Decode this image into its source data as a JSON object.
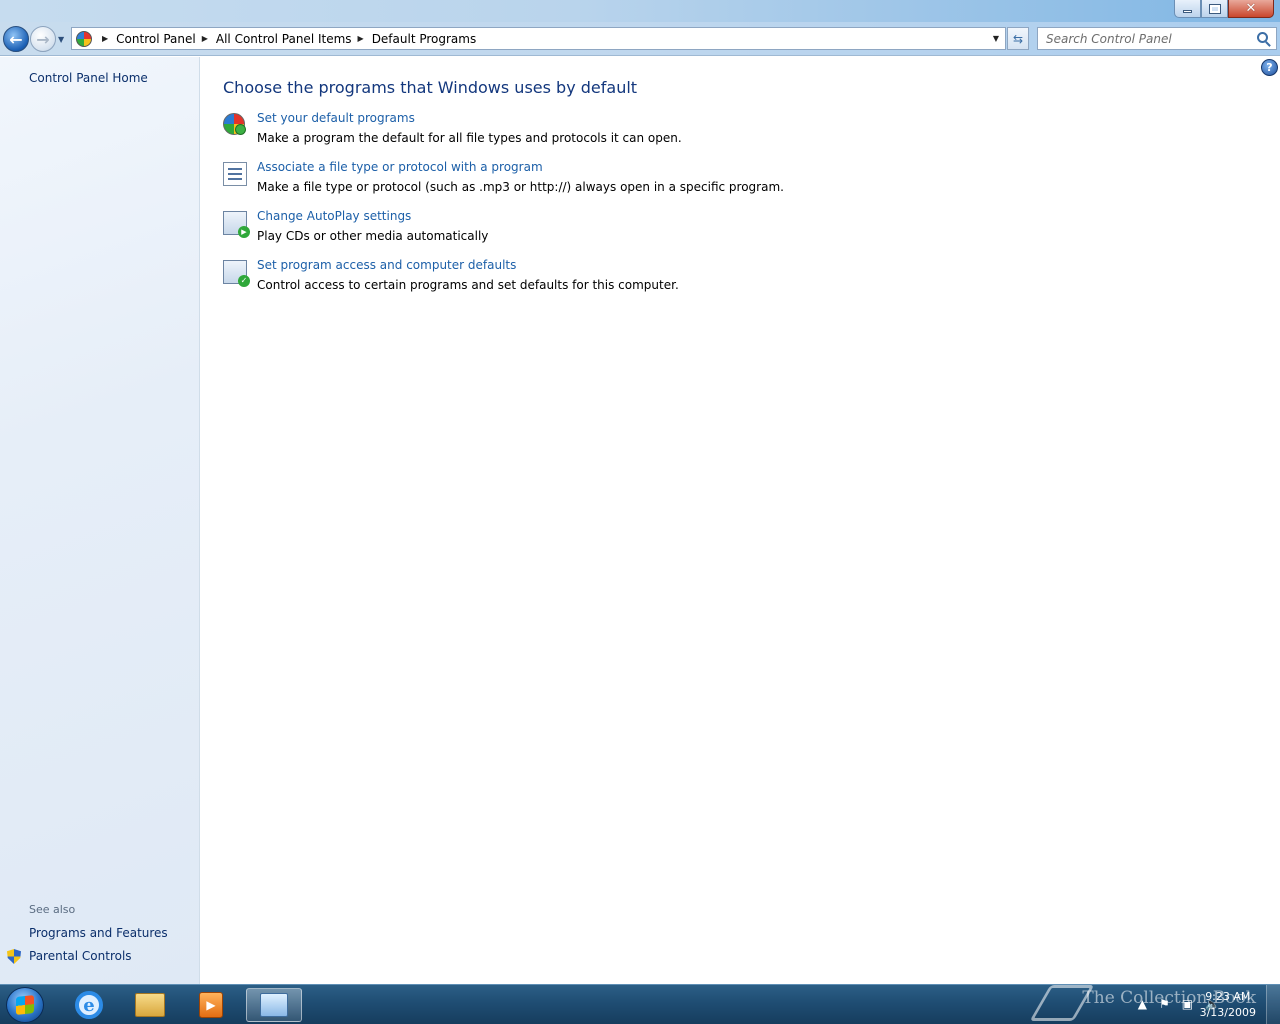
{
  "window": {
    "minimize": "minimize",
    "maximize": "maximize",
    "close": "close"
  },
  "navigation": {
    "breadcrumbs": [
      "Control Panel",
      "All Control Panel Items",
      "Default Programs"
    ],
    "search_placeholder": "Search Control Panel"
  },
  "left_pane": {
    "home_link": "Control Panel Home",
    "see_also_title": "See also",
    "see_also_links": [
      "Programs and Features",
      "Parental Controls"
    ]
  },
  "main": {
    "title": "Choose the programs that Windows uses by default",
    "help_label": "?",
    "tasks": [
      {
        "link": "Set your default programs",
        "description": "Make a program the default for all file types and protocols it can open.",
        "icon": "default-programs-icon"
      },
      {
        "link": "Associate a file type or protocol with a program",
        "description": "Make a file type or protocol (such as .mp3 or http://) always open in a specific program.",
        "icon": "file-association-icon"
      },
      {
        "link": "Change AutoPlay settings",
        "description": "Play CDs or other media automatically",
        "icon": "autoplay-icon"
      },
      {
        "link": "Set program access and computer defaults",
        "description": "Control access to certain programs and set defaults for this computer.",
        "icon": "program-access-icon"
      }
    ]
  },
  "taskbar": {
    "pinned": [
      "internet-explorer-icon",
      "windows-explorer-icon",
      "media-player-icon",
      "control-panel-icon"
    ],
    "clock_time": "9:23 AM",
    "clock_date": "3/13/2009",
    "watermark": "The Collection Book"
  }
}
